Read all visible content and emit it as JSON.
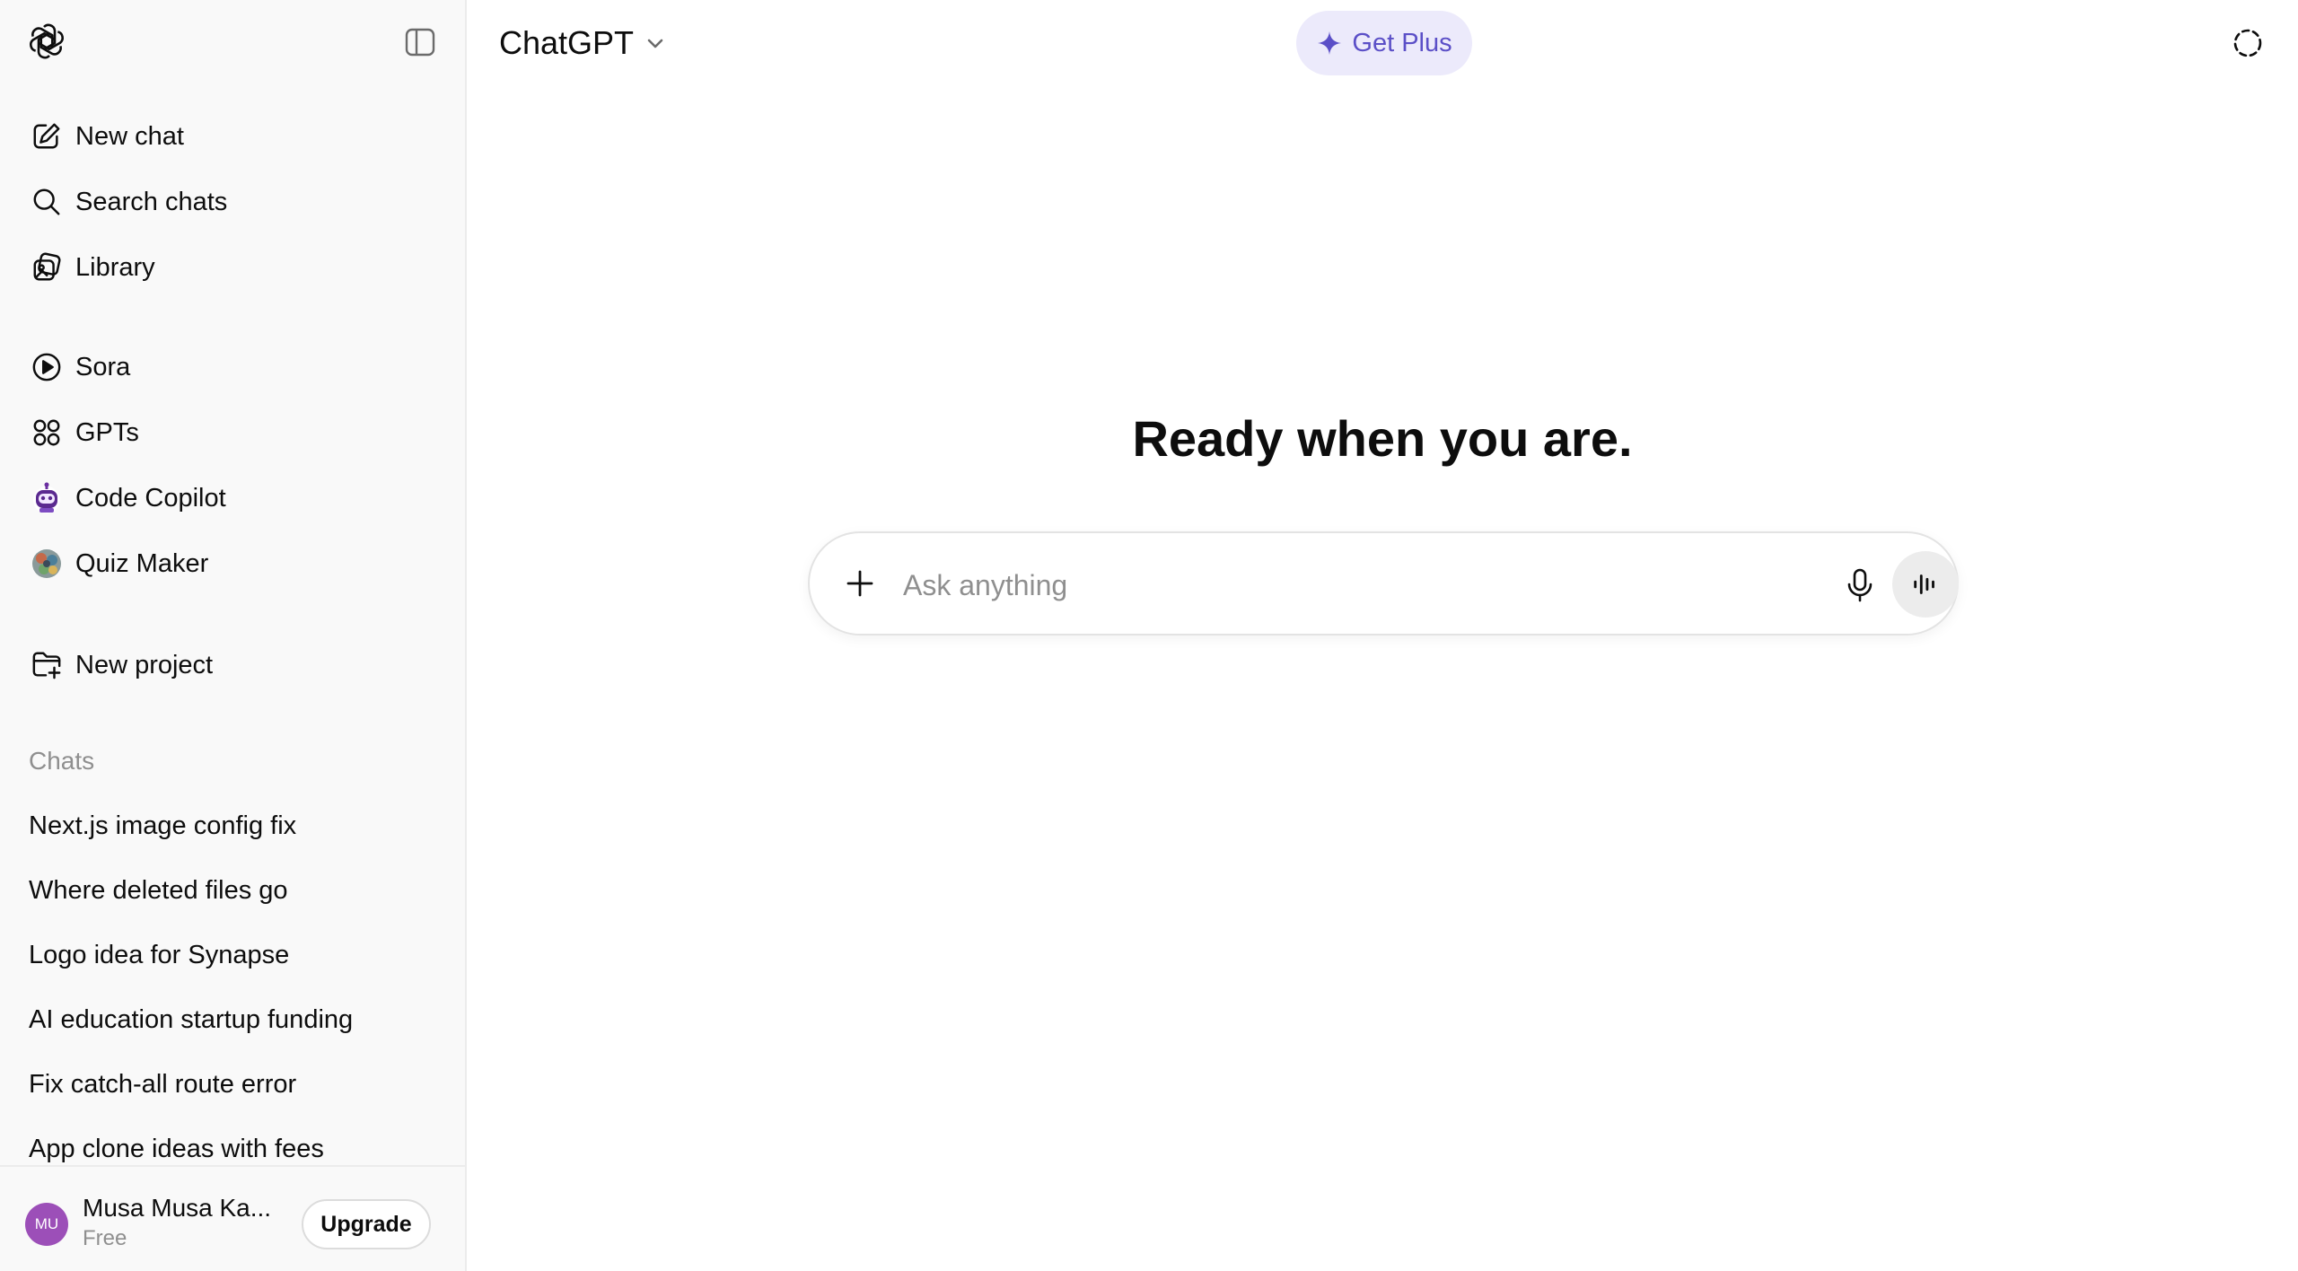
{
  "sidebar": {
    "primary_items": [
      {
        "label": "New chat",
        "icon": "edit-icon"
      },
      {
        "label": "Search chats",
        "icon": "search-icon"
      },
      {
        "label": "Library",
        "icon": "library-icon"
      }
    ],
    "app_items": [
      {
        "label": "Sora",
        "icon": "play-circle-icon"
      },
      {
        "label": "GPTs",
        "icon": "grid-icon"
      },
      {
        "label": "Code Copilot",
        "icon": "robot-avatar-icon"
      },
      {
        "label": "Quiz Maker",
        "icon": "quiz-maker-avatar-icon"
      }
    ],
    "project_item": {
      "label": "New project",
      "icon": "folder-plus-icon"
    },
    "chats_title": "Chats",
    "chats": [
      "Next.js image config fix",
      "Where deleted files go",
      "Logo idea for Synapse",
      "AI education startup funding",
      "Fix catch-all route error",
      "App clone ideas with fees"
    ],
    "user": {
      "initials": "MU",
      "name": "Musa Musa Ka...",
      "plan": "Free",
      "upgrade_label": "Upgrade"
    }
  },
  "header": {
    "model_name": "ChatGPT",
    "get_plus_label": "Get Plus"
  },
  "main": {
    "headline": "Ready when you are.",
    "composer": {
      "placeholder": "Ask anything",
      "value": ""
    }
  },
  "colors": {
    "sidebar_bg": "#f9f9f9",
    "accent_plus": "#5b4fc7",
    "plus_bg": "#eceafb",
    "avatar_bg": "#9c4fb8"
  }
}
